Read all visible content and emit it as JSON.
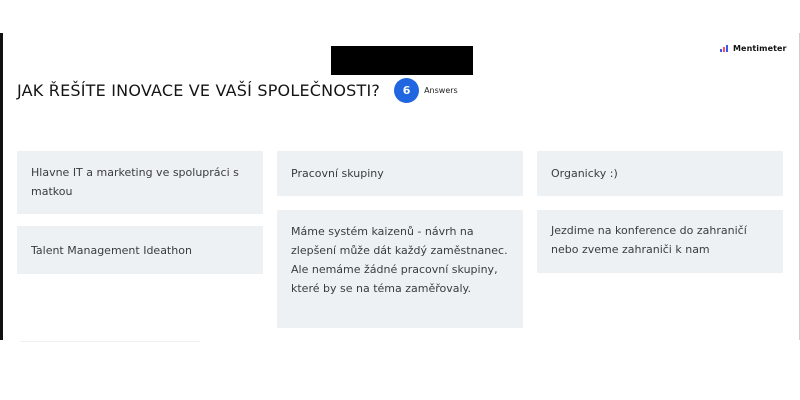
{
  "brand": {
    "name": "Mentimeter"
  },
  "question": {
    "title": "JAK ŘEŠÍTE INOVACE VE VAŠÍ SPOLEČNOSTI?",
    "answer_count": "6",
    "answers_label": "Answers"
  },
  "answers": [
    "Hlavne IT a marketing ve spolupráci s matkou",
    "Talent Management Ideathon",
    "Pracovní skupiny",
    "Máme systém kaizenů - návrh na zlepšení může dát každý zaměstnanec. Ale nemáme žádné pracovní skupiny, které by se na téma zaměřovaly.",
    "Organicky :)",
    "Jezdime na konference do zahraničí nebo zveme zahraniči k nam"
  ],
  "colors": {
    "accent": "#1f66e0",
    "card_background": "#eef1f3",
    "logo_blue": "#3b57f6",
    "logo_pink": "#ff4d6d"
  },
  "icons": {
    "brand_logo": "mentimeter-logo-icon"
  }
}
